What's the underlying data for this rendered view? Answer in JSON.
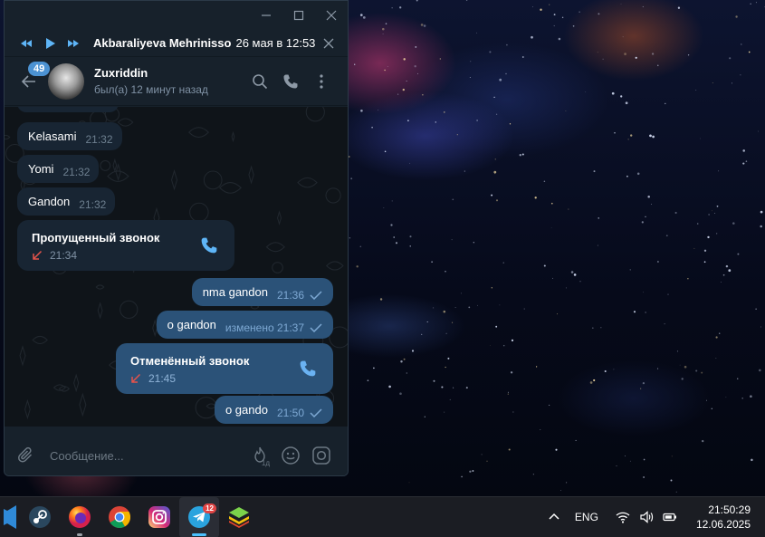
{
  "player": {
    "title": "Akbaraliyeva Mehrinisso",
    "date": "26 мая в 12:53"
  },
  "chat_header": {
    "unread_count": "49",
    "peer_name": "Zuxriddin",
    "peer_status": "был(а) 12 минут назад"
  },
  "messages": [
    {
      "type": "text",
      "direction": "in",
      "text": "Kelasami",
      "time": "21:32"
    },
    {
      "type": "text",
      "direction": "in",
      "text": "Yomi",
      "time": "21:32"
    },
    {
      "type": "text",
      "direction": "in",
      "text": "Gandon",
      "time": "21:32"
    },
    {
      "type": "call",
      "direction": "in",
      "title": "Пропущенный звонок",
      "time": "21:34"
    },
    {
      "type": "text",
      "direction": "out",
      "text": "nma gandon",
      "time": "21:36"
    },
    {
      "type": "text",
      "direction": "out",
      "text": "o  gandon",
      "time": "изменено 21:37"
    },
    {
      "type": "call",
      "direction": "out",
      "title": "Отменённый звонок",
      "time": "21:45"
    },
    {
      "type": "text",
      "direction": "out",
      "text": "o gando",
      "time": "21:50"
    }
  ],
  "composer": {
    "placeholder": "Сообщение...",
    "timer_label": "1д"
  },
  "taskbar": {
    "apps": [
      "vscode-icon",
      "steam-icon",
      "firefox-icon",
      "chrome-icon",
      "instagram-icon",
      "telegram-icon",
      "bluestacks-icon"
    ],
    "telegram_badge": "12",
    "language": "ENG",
    "time": "21:50:29",
    "date": "12.06.2025"
  },
  "colors": {
    "accent": "#5eb5f7",
    "incoming_bubble": "#182533",
    "outgoing_bubble": "#2b5278",
    "missed_call": "#e5534b"
  }
}
